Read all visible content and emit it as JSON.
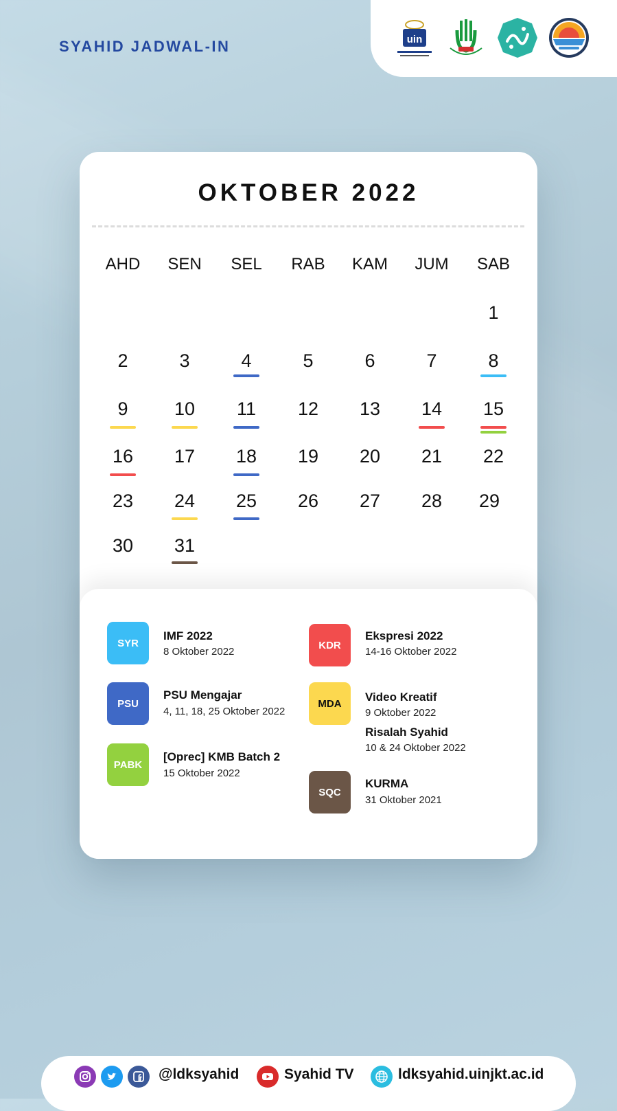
{
  "header": {
    "brand": "SYAHID JADWAL-IN",
    "logos": [
      "uin-logo",
      "fsldk-logo",
      "arabic-calligraphy-logo",
      "ldk-syahid-logo"
    ]
  },
  "calendar": {
    "title": "OKTOBER 2022",
    "weekdays": [
      "AHD",
      "SEN",
      "SEL",
      "RAB",
      "KAM",
      "JUM",
      "SAB"
    ],
    "days": [
      "1",
      "2",
      "3",
      "4",
      "5",
      "6",
      "7",
      "8",
      "9",
      "10",
      "11",
      "12",
      "13",
      "14",
      "15",
      "16",
      "17",
      "18",
      "19",
      "20",
      "21",
      "22",
      "23",
      "24",
      "25",
      "26",
      "27",
      "28",
      "29",
      "30",
      "31"
    ]
  },
  "colors": {
    "syr": "#3bbdf6",
    "psu": "#3f69c6",
    "pabk": "#93d13f",
    "kdr": "#f24d4d",
    "mda": "#fcd84f",
    "sqc": "#6b5647",
    "brand": "#2449a0"
  },
  "legend": {
    "syr": {
      "badge": "SYR",
      "title": "IMF 2022",
      "date": "8 Oktober 2022"
    },
    "psu": {
      "badge": "PSU",
      "title": "PSU Mengajar",
      "date": "4, 11, 18, 25 Oktober 2022"
    },
    "pabk": {
      "badge": "PABK",
      "title": "[Oprec] KMB Batch 2",
      "date": "15 Oktober 2022"
    },
    "kdr": {
      "badge": "KDR",
      "title": "Ekspresi 2022",
      "date": "14-16 Oktober 2022"
    },
    "mda": {
      "badge": "MDA",
      "title1": "Video Kreatif",
      "date1": "9 Oktober 2022",
      "title2": "Risalah Syahid",
      "date2": "10 & 24 Oktober 2022"
    },
    "sqc": {
      "badge": "SQC",
      "title": "KURMA",
      "date": "31 Oktober 2021"
    }
  },
  "footer": {
    "handle": "@ldksyahid",
    "youtube": "Syahid TV",
    "website": "ldksyahid.uinjkt.ac.id",
    "icons": [
      "instagram-icon",
      "twitter-icon",
      "facebook-icon",
      "youtube-icon",
      "globe-icon"
    ]
  }
}
